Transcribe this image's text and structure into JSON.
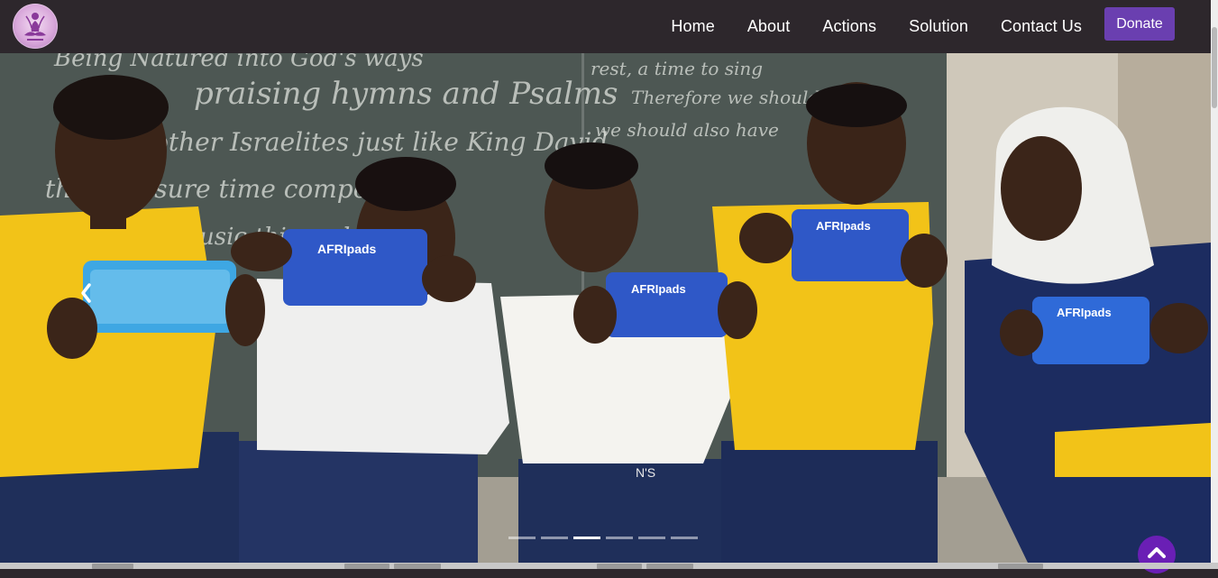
{
  "nav": {
    "links": [
      "Home",
      "About",
      "Actions",
      "Solution",
      "Contact Us"
    ],
    "donate_label": "Donate"
  },
  "hero": {
    "chalkboard_lines": [
      "Being Natured into God's ways",
      "praising hymns and Psalms",
      "other Israelites just like King David",
      "their Leisure time compose",
      "to Music this and their",
      "rest, a time to sing",
      "Therefore we should",
      "we should also have"
    ],
    "shirt_label": "N'S",
    "pack_label": "AFRIpads",
    "carousel": {
      "slide_count": 6,
      "active_index": 2
    }
  },
  "colors": {
    "navbar": "#2d272c",
    "donate": "#6a3fb0",
    "back_to_top": "#6a1fb5",
    "logo": "#d9a8db"
  },
  "icons": {
    "prev": "chevron-left-icon",
    "to_top": "chevron-up-icon",
    "logo": "meditation-logo-icon"
  }
}
